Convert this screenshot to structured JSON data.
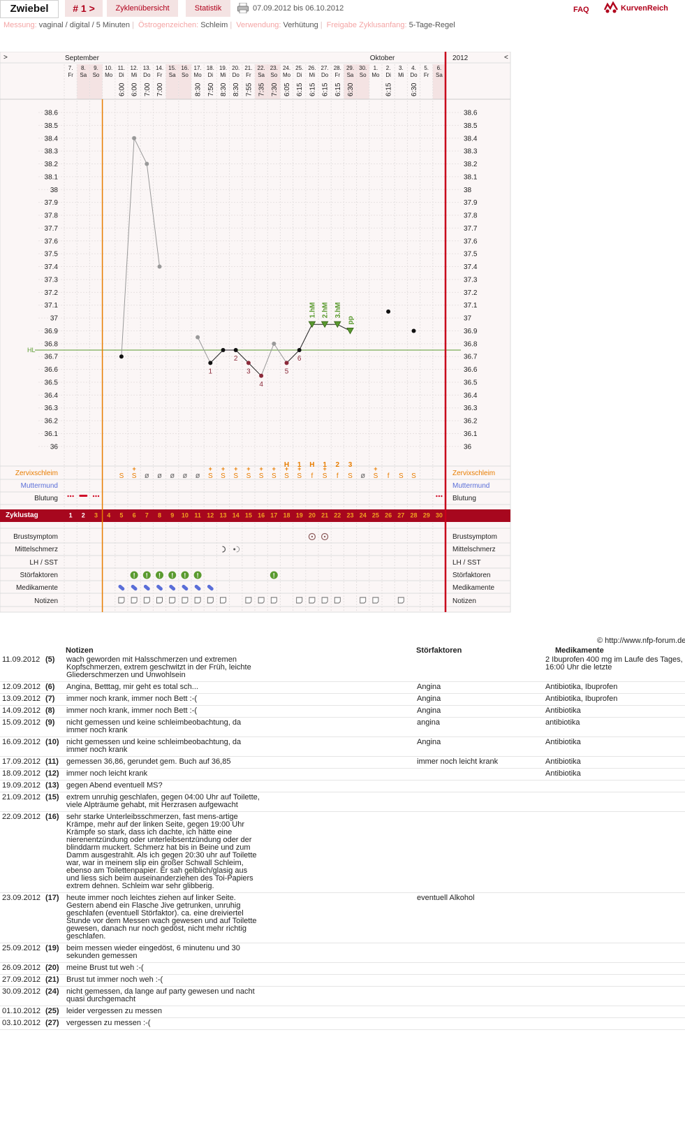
{
  "header": {
    "username": "Zwiebel",
    "cycle_nav": "# 1 >",
    "tab_overview": "Zyklenübersicht",
    "tab_stats": "Statistik",
    "date_range": "07.09.2012 bis 06.10.2012",
    "faq": "FAQ",
    "logo_text": "KurvenReich"
  },
  "meta": [
    {
      "label": "Messung:",
      "value": "vaginal / digital / 5 Minuten"
    },
    {
      "label": "Östrogenzeichen:",
      "value": "Schleim"
    },
    {
      "label": "Verwendung:",
      "value": "Verhütung"
    },
    {
      "label": "Freigabe Zyklusanfang:",
      "value": "5-Tage-Regel"
    }
  ],
  "chart_data": {
    "type": "line",
    "nav_left": ">",
    "nav_right": "<",
    "month_labels": [
      {
        "text": "September",
        "day": 0
      },
      {
        "text": "Oktober",
        "day": 24
      }
    ],
    "year_label": "2012",
    "days": [
      {
        "d": "7.",
        "wd": "Fr",
        "time": "",
        "we": false
      },
      {
        "d": "8.",
        "wd": "Sa",
        "time": "",
        "we": true
      },
      {
        "d": "9.",
        "wd": "So",
        "time": "",
        "we": true
      },
      {
        "d": "10.",
        "wd": "Mo",
        "time": "",
        "we": false
      },
      {
        "d": "11.",
        "wd": "Di",
        "time": "6:00",
        "we": false
      },
      {
        "d": "12.",
        "wd": "Mi",
        "time": "6:00",
        "we": false
      },
      {
        "d": "13.",
        "wd": "Do",
        "time": "7:00",
        "we": false
      },
      {
        "d": "14.",
        "wd": "Fr",
        "time": "7:00",
        "we": false
      },
      {
        "d": "15.",
        "wd": "Sa",
        "time": "",
        "we": true
      },
      {
        "d": "16.",
        "wd": "So",
        "time": "",
        "we": true
      },
      {
        "d": "17.",
        "wd": "Mo",
        "time": "8:30",
        "we": false
      },
      {
        "d": "18.",
        "wd": "Di",
        "time": "7:50",
        "we": false
      },
      {
        "d": "19.",
        "wd": "Mi",
        "time": "8:30",
        "we": false
      },
      {
        "d": "20.",
        "wd": "Do",
        "time": "8:30",
        "we": false
      },
      {
        "d": "21.",
        "wd": "Fr",
        "time": "7:55",
        "we": false
      },
      {
        "d": "22.",
        "wd": "Sa",
        "time": "7:35",
        "we": true
      },
      {
        "d": "23.",
        "wd": "So",
        "time": "7:30",
        "we": true
      },
      {
        "d": "24.",
        "wd": "Mo",
        "time": "6:05",
        "we": false
      },
      {
        "d": "25.",
        "wd": "Di",
        "time": "6:15",
        "we": false
      },
      {
        "d": "26.",
        "wd": "Mi",
        "time": "6:15",
        "we": false
      },
      {
        "d": "27.",
        "wd": "Do",
        "time": "6:15",
        "we": false
      },
      {
        "d": "28.",
        "wd": "Fr",
        "time": "6:15",
        "we": false
      },
      {
        "d": "29.",
        "wd": "Sa",
        "time": "6:30",
        "we": true
      },
      {
        "d": "30.",
        "wd": "So",
        "time": "",
        "we": true
      },
      {
        "d": "1.",
        "wd": "Mo",
        "time": "",
        "we": false
      },
      {
        "d": "2.",
        "wd": "Di",
        "time": "6:15",
        "we": false
      },
      {
        "d": "3.",
        "wd": "Mi",
        "time": "",
        "we": false
      },
      {
        "d": "4.",
        "wd": "Do",
        "time": "6:30",
        "we": false
      },
      {
        "d": "5.",
        "wd": "Fr",
        "time": "",
        "we": false
      },
      {
        "d": "6.",
        "wd": "Sa",
        "time": "",
        "we": true
      }
    ],
    "ylim": [
      36.0,
      38.6
    ],
    "y_ticks": [
      "38.6",
      "38.5",
      "38.4",
      "38.3",
      "38.2",
      "38.1",
      "38",
      "37.9",
      "37.8",
      "37.7",
      "37.6",
      "37.5",
      "37.4",
      "37.3",
      "37.2",
      "37.1",
      "37",
      "36.9",
      "36.8",
      "36.7",
      "36.6",
      "36.5",
      "36.4",
      "36.3",
      "36.2",
      "36.1",
      "36"
    ],
    "cover_line": {
      "label": "HL",
      "value": 36.75,
      "color": "#5a9a2f"
    },
    "cycle_start_marker_day": 3,
    "sick_series": {
      "color": "#999999",
      "points": [
        {
          "day": 4,
          "v": 36.7
        },
        {
          "day": 5,
          "v": 38.4
        },
        {
          "day": 6,
          "v": 38.2
        },
        {
          "day": 7,
          "v": 37.4
        }
      ]
    },
    "gap_points": [
      {
        "day": 10,
        "v": 36.85,
        "c": "#999999"
      },
      {
        "day": 16,
        "v": 36.8,
        "c": "#999999"
      }
    ],
    "main_points": [
      {
        "day": 11,
        "v": 36.65,
        "c": "#111111"
      },
      {
        "day": 12,
        "v": 36.75,
        "c": "#111111"
      },
      {
        "day": 13,
        "v": 36.75,
        "c": "#111111"
      },
      {
        "day": 14,
        "v": 36.65,
        "c": "#8b2a3a"
      },
      {
        "day": 15,
        "v": 36.55,
        "c": "#8b2a3a"
      },
      {
        "day": 17,
        "v": 36.65,
        "c": "#8b2a3a"
      },
      {
        "day": 18,
        "v": 36.75,
        "c": "#111111"
      },
      {
        "day": 19,
        "v": 36.95,
        "c": "#111111"
      },
      {
        "day": 20,
        "v": 36.95,
        "c": "#111111"
      },
      {
        "day": 21,
        "v": 36.95,
        "c": "#111111"
      },
      {
        "day": 22,
        "v": 36.9,
        "c": "#111111"
      }
    ],
    "single_points": [
      {
        "day": 25,
        "v": 37.05,
        "c": "#111111"
      },
      {
        "day": 27,
        "v": 36.9,
        "c": "#111111"
      }
    ],
    "low_labels": [
      {
        "day": 11,
        "v": 36.65,
        "t": "1"
      },
      {
        "day": 13,
        "v": 36.75,
        "t": "2"
      },
      {
        "day": 14,
        "v": 36.65,
        "t": "3"
      },
      {
        "day": 15,
        "v": 36.55,
        "t": "4"
      },
      {
        "day": 17,
        "v": 36.65,
        "t": "5"
      },
      {
        "day": 18,
        "v": 36.75,
        "t": "6"
      }
    ],
    "high_labels": [
      {
        "day": 19,
        "v": 36.95,
        "t": "1.hM"
      },
      {
        "day": 20,
        "v": 36.95,
        "t": "2.hM"
      },
      {
        "day": 21,
        "v": 36.95,
        "t": "3.hM"
      },
      {
        "day": 22,
        "v": 36.9,
        "t": "pp"
      }
    ],
    "high_triangles_days": [
      19,
      20,
      21,
      22
    ],
    "mucus_high": [
      {
        "day": 17,
        "t": "H"
      },
      {
        "day": 18,
        "t": "1"
      },
      {
        "day": 19,
        "t": "H"
      },
      {
        "day": 20,
        "t": "1"
      },
      {
        "day": 21,
        "t": "2"
      },
      {
        "day": 22,
        "t": "3"
      }
    ],
    "rows": {
      "zervix": "Zervixschleim",
      "muttermund": "Muttermund",
      "blutung": "Blutung",
      "zyklustag": "Zyklustag",
      "brust": "Brustsymptom",
      "mittel": "Mittelschmerz",
      "lh": "LH / SST",
      "stoer": "Störfaktoren",
      "medik": "Medikamente",
      "notizen": "Notizen"
    },
    "mucus": [
      "",
      "",
      "",
      "",
      "S",
      "S+",
      "ø",
      "ø",
      "ø",
      "ø",
      "ø",
      "S+",
      "S+",
      "S+",
      "S+",
      "S+",
      "S+",
      "S+",
      "S+",
      "f",
      "S+",
      "f",
      "S",
      "ø",
      "S+",
      "f",
      "S",
      "S",
      "",
      ""
    ],
    "bleeding": [
      "dots",
      "bar",
      "dots",
      "",
      "",
      "",
      "",
      "",
      "",
      "",
      "",
      "",
      "",
      "",
      "",
      "",
      "",
      "",
      "",
      "",
      "",
      "",
      "",
      "",
      "",
      "",
      "",
      "",
      "",
      "dots"
    ],
    "cycle_days": [
      "1",
      "2",
      "3",
      "4",
      "5",
      "6",
      "7",
      "8",
      "9",
      "10",
      "11",
      "12",
      "13",
      "14",
      "15",
      "16",
      "17",
      "18",
      "19",
      "20",
      "21",
      "22",
      "23",
      "24",
      "25",
      "26",
      "27",
      "28",
      "29",
      "30"
    ],
    "brust_days": [
      19,
      20
    ],
    "mittel": [
      {
        "day": 12,
        "s": "left"
      },
      {
        "day": 13,
        "s": "right"
      }
    ],
    "stoer_days": [
      5,
      6,
      7,
      8,
      9,
      10,
      16
    ],
    "medik_days": [
      4,
      5,
      6,
      7,
      8,
      9,
      10,
      11
    ],
    "notes_days": [
      4,
      5,
      6,
      7,
      8,
      9,
      10,
      11,
      12,
      14,
      15,
      16,
      18,
      19,
      20,
      21,
      23,
      24,
      26
    ]
  },
  "footer": {
    "source": "© http://www.nfp-forum.de"
  },
  "notes_table": {
    "headers": {
      "notes": "Notizen",
      "stoer": "Störfaktoren",
      "medik": "Medikamente"
    },
    "rows": [
      {
        "date": "11.09.2012",
        "cday": "(5)",
        "note": "wach geworden mit Halsschmerzen und extremen Kopfschmerzen, extrem geschwitzt in der Früh, leichte Gliederschmerzen und Unwohlsein",
        "stoer": "",
        "medik": "2 Ibuprofen 400 mg im Laufe des Tages, 16:00 Uhr die letzte"
      },
      {
        "date": "12.09.2012",
        "cday": "(6)",
        "note": "Angina, Betttag, mir geht es total sch...",
        "stoer": "Angina",
        "medik": "Antibiotika, Ibuprofen"
      },
      {
        "date": "13.09.2012",
        "cday": "(7)",
        "note": "immer noch krank, immer noch Bett :-(",
        "stoer": "Angina",
        "medik": "Antibiotika, Ibuprofen"
      },
      {
        "date": "14.09.2012",
        "cday": "(8)",
        "note": "immer noch krank, immer noch Bett :-(",
        "stoer": "Angina",
        "medik": "Antibiotika"
      },
      {
        "date": "15.09.2012",
        "cday": "(9)",
        "note": "nicht gemessen und keine schleimbeobachtung, da immer noch krank",
        "stoer": "angina",
        "medik": "antibiotika"
      },
      {
        "date": "16.09.2012",
        "cday": "(10)",
        "note": "nicht gemessen und keine schleimbeobachtung, da immer noch krank",
        "stoer": "Angina",
        "medik": "Antibiotika"
      },
      {
        "date": "17.09.2012",
        "cday": "(11)",
        "note": "gemessen 36,86, gerundet gem. Buch auf 36,85",
        "stoer": "immer noch leicht krank",
        "medik": "Antibiotika"
      },
      {
        "date": "18.09.2012",
        "cday": "(12)",
        "note": "immer noch leicht krank",
        "stoer": "",
        "medik": "Antibiotika"
      },
      {
        "date": "19.09.2012",
        "cday": "(13)",
        "note": "gegen Abend eventuell MS?",
        "stoer": "",
        "medik": ""
      },
      {
        "date": "21.09.2012",
        "cday": "(15)",
        "note": "extrem unruhig geschlafen, gegen 04:00 Uhr auf Toilette, viele Alpträume gehabt, mit Herzrasen aufgewacht",
        "stoer": "",
        "medik": ""
      },
      {
        "date": "22.09.2012",
        "cday": "(16)",
        "note": "sehr starke Unterleibsschmerzen, fast mens-artige Krämpe, mehr auf der linken Seite, gegen 19:00 Uhr Krämpfe so stark, dass ich dachte, ich hätte eine nierenentzündung oder unterleibsentzündung oder der blinddarm muckert. Schmerz hat bis in Beine und zum Damm ausgestrahlt. Als ich gegen 20:30 uhr auf Toilette war, war in meinem slip ein großer Schwall Schleim, ebenso am Toilettenpapier. Er sah gelblich/glasig aus und liess sich beim auseinanderziehen des Toi-Papiers extrem dehnen. Schleim war sehr glibberig.",
        "stoer": "",
        "medik": ""
      },
      {
        "date": "23.09.2012",
        "cday": "(17)",
        "note": "heute immer noch leichtes ziehen auf linker Seite. Gestern abend ein Flasche Jive getrunken, unruhig geschlafen (eventuell Störfaktor). ca. eine dreiviertel Stunde vor dem Messen wach gewesen und auf Toilette gewesen, danach nur noch gedöst, nicht mehr richtig geschlafen.",
        "stoer": "eventuell Alkohol",
        "medik": ""
      },
      {
        "date": "25.09.2012",
        "cday": "(19)",
        "note": "beim messen wieder eingedöst, 6 minutenu und 30 sekunden gemessen",
        "stoer": "",
        "medik": ""
      },
      {
        "date": "26.09.2012",
        "cday": "(20)",
        "note": "meine Brust tut weh :-(",
        "stoer": "",
        "medik": ""
      },
      {
        "date": "27.09.2012",
        "cday": "(21)",
        "note": "Brust tut immer noch weh :-(",
        "stoer": "",
        "medik": ""
      },
      {
        "date": "30.09.2012",
        "cday": "(24)",
        "note": "nicht gemessen, da lange auf party gewesen und nacht quasi durchgemacht",
        "stoer": "",
        "medik": ""
      },
      {
        "date": "01.10.2012",
        "cday": "(25)",
        "note": "leider vergessen zu messen",
        "stoer": "",
        "medik": ""
      },
      {
        "date": "03.10.2012",
        "cday": "(27)",
        "note": "vergessen zu messen :-(",
        "stoer": "",
        "medik": ""
      }
    ]
  },
  "colors": {
    "brand": "#b0001b",
    "orange": "#e87d00",
    "mucus": "#e87d00",
    "blue": "#5a6ed8",
    "green": "#5a9a2f",
    "weekend": "#f4e3e3"
  }
}
